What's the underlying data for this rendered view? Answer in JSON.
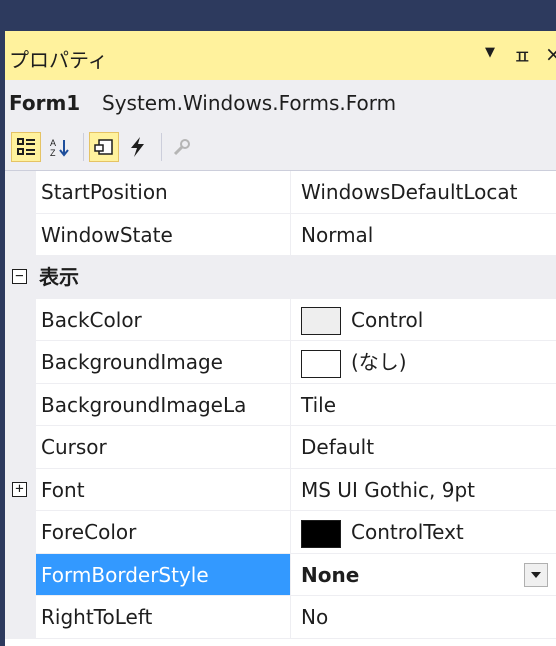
{
  "panel": {
    "title": "プロパティ",
    "dropdown_icon": "▼",
    "pin_icon": "ㅍ",
    "close_icon": "×"
  },
  "object": {
    "name": "Form1",
    "type": "System.Windows.Forms.Form"
  },
  "toolbar": {
    "buttons": [
      {
        "name": "categorized-view-icon",
        "active": true
      },
      {
        "name": "alphabetical-sort-icon",
        "active": false
      },
      {
        "name": "properties-icon",
        "active": true
      },
      {
        "name": "events-icon",
        "active": false
      },
      {
        "name": "property-pages-icon",
        "disabled": true
      }
    ]
  },
  "rows": {
    "r0": {
      "name": "StartPosition",
      "value": "WindowsDefaultLocat"
    },
    "r1": {
      "name": "WindowState",
      "value": "Normal"
    },
    "cat1": {
      "label": "表示",
      "expander": "−"
    },
    "r2": {
      "name": "BackColor",
      "value": "Control",
      "swatch": "#eeeeee"
    },
    "r3": {
      "name": "BackgroundImage",
      "value": "(なし)",
      "swatch": "#ffffff"
    },
    "r4": {
      "name": "BackgroundImageLa",
      "value": "Tile"
    },
    "r5": {
      "name": "Cursor",
      "value": "Default"
    },
    "r6": {
      "name": "Font",
      "value": "MS UI Gothic, 9pt",
      "expander": "+"
    },
    "r7": {
      "name": "ForeColor",
      "value": "ControlText",
      "swatch": "#000000"
    },
    "r8": {
      "name": "FormBorderStyle",
      "value": "None",
      "selected": true
    },
    "r9": {
      "name": "RightToLeft",
      "value": "No"
    }
  },
  "colors": {
    "accent_yellow": "#fff29d",
    "selection_blue": "#3399ff",
    "frame_navy": "#2d3a5e"
  }
}
